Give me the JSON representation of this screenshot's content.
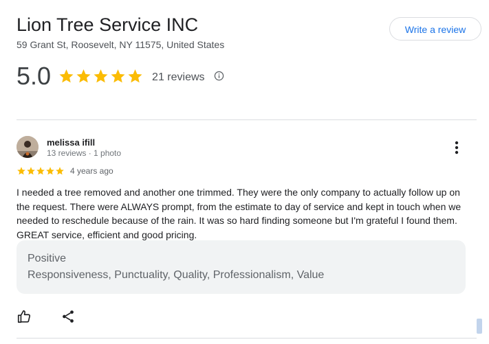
{
  "business": {
    "name": "Lion Tree Service INC",
    "address": "59 Grant St, Roosevelt, NY 11575, United States"
  },
  "write_review_label": "Write a review",
  "rating": {
    "value": "5.0",
    "stars": 5,
    "review_count": "21 reviews"
  },
  "review": {
    "author": "melissa ifill",
    "meta": "13 reviews · 1 photo",
    "stars": 5,
    "age": "4 years ago",
    "text": "I needed a tree removed and another one trimmed. They were the only company to actually follow up on the request. There were ALWAYS prompt, from the estimate to day of service and kept in touch when we needed to reschedule because of the rain. It was so hard finding someone but I'm grateful I found them. GREAT service, efficient and good pricing.",
    "tags": {
      "heading": "Positive",
      "list": "Responsiveness, Punctuality, Quality, Professionalism, Value"
    }
  },
  "icons": {
    "star": "star-icon",
    "info": "info-icon",
    "more": "more-vert-icon",
    "like": "thumb-up-icon",
    "share": "share-icon"
  },
  "colors": {
    "star": "#fbbc04",
    "link": "#1a73e8",
    "tag_background": "#f1f3f4"
  }
}
